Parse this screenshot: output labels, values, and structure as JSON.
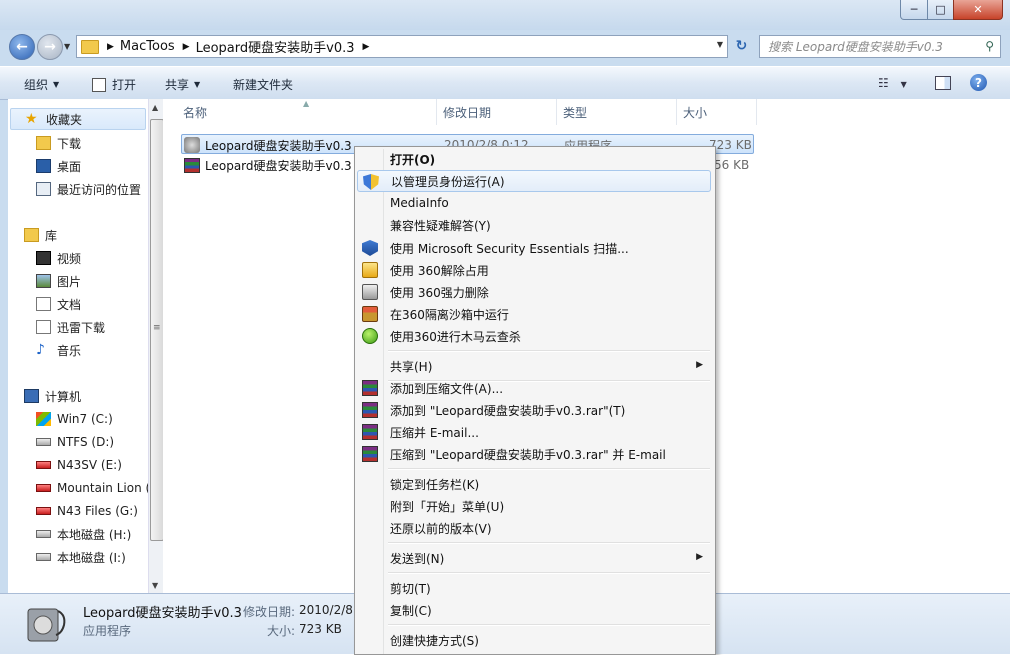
{
  "window": {
    "controls": {
      "minimize": "─",
      "maximize": "□",
      "close": "✕"
    }
  },
  "navigation": {
    "back": "←",
    "forward": "→",
    "breadcrumb": [
      "MacToos",
      "Leopard硬盘安装助手v0.3"
    ],
    "refresh": "↻",
    "search_placeholder": "搜索 Leopard硬盘安装助手v0.3"
  },
  "toolbar": {
    "organize": "组织",
    "open": "打开",
    "share": "共享",
    "new_folder": "新建文件夹",
    "help": "?"
  },
  "sidebar": {
    "favorites": {
      "title": "收藏夹",
      "items": [
        "下载",
        "桌面",
        "最近访问的位置"
      ]
    },
    "libraries": {
      "title": "库",
      "items": [
        "视频",
        "图片",
        "文档",
        "迅雷下载",
        "音乐"
      ]
    },
    "computer": {
      "title": "计算机",
      "items": [
        "Win7 (C:)",
        "NTFS (D:)",
        "N43SV (E:)",
        "Mountain Lion (",
        "N43 Files (G:)",
        "本地磁盘 (H:)",
        "本地磁盘 (I:)"
      ]
    }
  },
  "columns": {
    "name": "名称",
    "date": "修改日期",
    "type": "类型",
    "size": "大小"
  },
  "files": [
    {
      "name": "Leopard硬盘安装助手v0.3",
      "date": "2010/2/8 0:12",
      "type": "应用程序",
      "size": "723 KB",
      "selected": true
    },
    {
      "name": "Leopard硬盘安装助手v0.3",
      "date": "",
      "type": "",
      "size": "56 KB",
      "selected": false
    }
  ],
  "status": {
    "name": "Leopard硬盘安装助手v0.3",
    "date_label": "修改日期:",
    "date_value": "2010/2/8",
    "type": "应用程序",
    "size_label": "大小:",
    "size_value": "723 KB"
  },
  "context_menu": {
    "items": [
      {
        "label": "打开(O)",
        "icon": "none",
        "bold": true
      },
      {
        "label": "以管理员身份运行(A)",
        "icon": "uac-shield-icon",
        "highlighted": true
      },
      {
        "label": "MediaInfo",
        "icon": "none"
      },
      {
        "label": "兼容性疑难解答(Y)",
        "icon": "none"
      },
      {
        "label": "使用 Microsoft Security Essentials 扫描...",
        "icon": "mse-icon"
      },
      {
        "label": "使用 360解除占用",
        "icon": "360-unlock-icon"
      },
      {
        "label": "使用 360强力删除",
        "icon": "360-shred-icon"
      },
      {
        "label": "在360隔离沙箱中运行",
        "icon": "360-sandbox-icon"
      },
      {
        "label": "使用360进行木马云查杀",
        "icon": "360-cloud-scan-icon"
      },
      {
        "label": "共享(H)",
        "icon": "none",
        "submenu": true
      },
      {
        "label": "添加到压缩文件(A)...",
        "icon": "winrar-icon"
      },
      {
        "label": "添加到 \"Leopard硬盘安装助手v0.3.rar\"(T)",
        "icon": "winrar-icon"
      },
      {
        "label": "压缩并 E-mail...",
        "icon": "winrar-icon"
      },
      {
        "label": "压缩到 \"Leopard硬盘安装助手v0.3.rar\" 并 E-mail",
        "icon": "winrar-icon"
      },
      {
        "label": "锁定到任务栏(K)",
        "icon": "none"
      },
      {
        "label": "附到「开始」菜单(U)",
        "icon": "none"
      },
      {
        "label": "还原以前的版本(V)",
        "icon": "none"
      },
      {
        "label": "发送到(N)",
        "icon": "none",
        "submenu": true
      },
      {
        "label": "剪切(T)",
        "icon": "none"
      },
      {
        "label": "复制(C)",
        "icon": "none"
      },
      {
        "label": "创建快捷方式(S)",
        "icon": "none"
      }
    ]
  }
}
